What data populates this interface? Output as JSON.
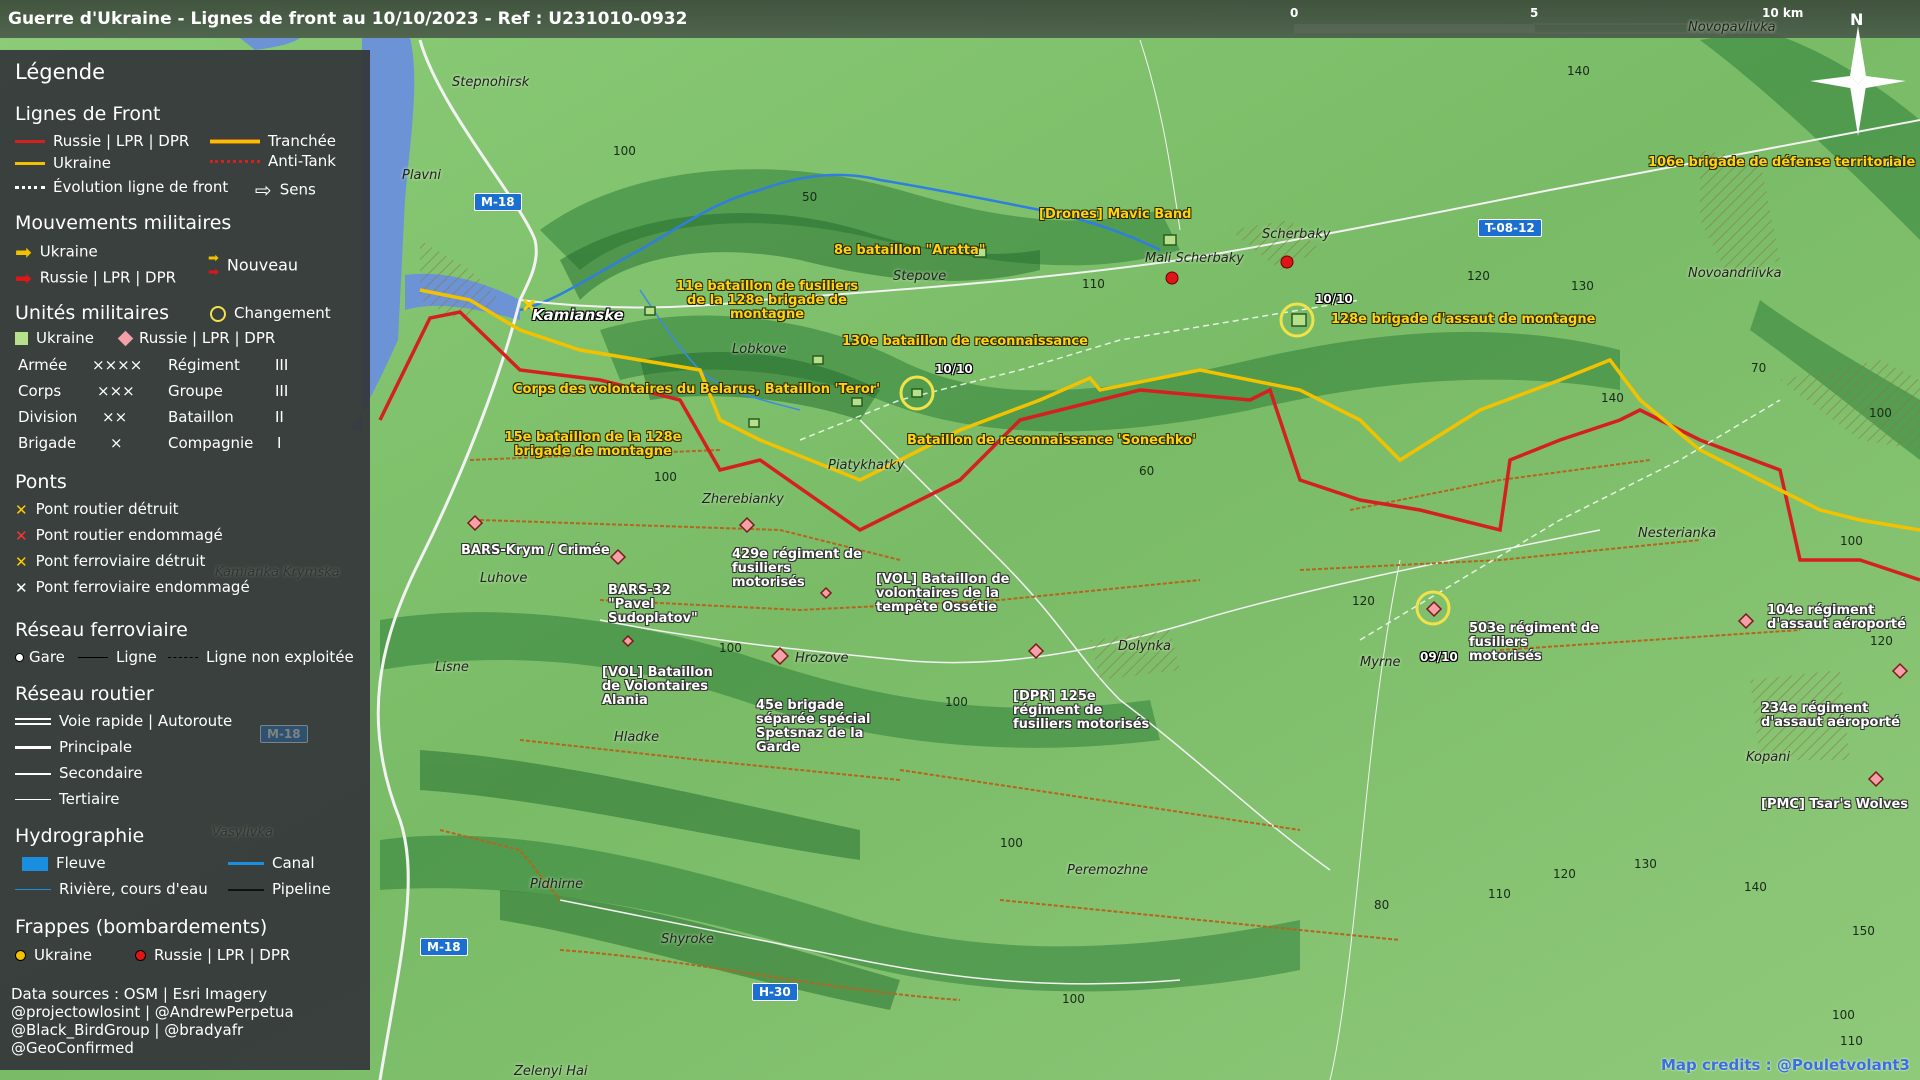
{
  "header": {
    "title": "Guerre d'Ukraine - Lignes de front au 10/10/2023 - Ref : U231010-0932",
    "scale_labels": [
      "0",
      "5",
      "10 km"
    ],
    "north_label": "N"
  },
  "legend": {
    "title": "Légende",
    "front_lines": {
      "heading": "Lignes de Front",
      "items": [
        "Russie | LPR | DPR",
        "Ukraine",
        "Évolution ligne de front",
        "Tranchée",
        "Anti-Tank",
        "Sens"
      ]
    },
    "movements": {
      "heading": "Mouvements militaires",
      "items": [
        "Ukraine",
        "Russie | LPR | DPR",
        "Nouveau"
      ]
    },
    "units": {
      "heading": "Unités militaires",
      "change_label": "Changement",
      "ukraine_label": "Ukraine",
      "russia_label": "Russie | LPR | DPR",
      "echelons": [
        {
          "name": "Armée",
          "symbol": "××××"
        },
        {
          "name": "Corps",
          "symbol": "×××"
        },
        {
          "name": "Division",
          "symbol": "××"
        },
        {
          "name": "Brigade",
          "symbol": "×"
        },
        {
          "name": "Régiment",
          "symbol": "III"
        },
        {
          "name": "Groupe",
          "symbol": "III"
        },
        {
          "name": "Bataillon",
          "symbol": "II"
        },
        {
          "name": "Compagnie",
          "symbol": "I"
        }
      ]
    },
    "bridges": {
      "heading": "Ponts",
      "items": [
        "Pont routier détruit",
        "Pont routier endommagé",
        "Pont ferroviaire détruit",
        "Pont ferroviaire endommagé"
      ],
      "colors": [
        "#ffcc00",
        "#ff3333",
        "#ffcc00",
        "#ffffff"
      ]
    },
    "rail": {
      "heading": "Réseau ferroviaire",
      "items": [
        "Gare",
        "Ligne",
        "Ligne non exploitée"
      ]
    },
    "roads": {
      "heading": "Réseau routier",
      "items": [
        "Voie rapide | Autoroute",
        "Principale",
        "Secondaire",
        "Tertiaire"
      ]
    },
    "hydro": {
      "heading": "Hydrographie",
      "items": [
        "Fleuve",
        "Canal",
        "Rivière, cours d'eau",
        "Pipeline"
      ]
    },
    "strikes": {
      "heading": "Frappes (bombardements)",
      "items": [
        "Ukraine",
        "Russie | LPR | DPR"
      ]
    },
    "credits": [
      "Data sources : OSM | Esri Imagery",
      "@projectowlosint | @AndrewPerpetua",
      "@Black_BirdGroup | @bradyafr",
      "@GeoConfirmed"
    ]
  },
  "map": {
    "colors": {
      "russia": "#d42020",
      "ukraine": "#f2c200",
      "ukraine_unit": "#b7e08a",
      "russia_unit": "#f4a0a8",
      "water": "#6b93d6",
      "river": "#2e7fe0"
    },
    "shields": [
      "M-18",
      "M-18",
      "T-08-12",
      "H-30",
      "M-18"
    ],
    "towns": [
      "Stepnohirsk",
      "Plavni",
      "Kamianske",
      "Lobkove",
      "Stepove",
      "Mali Scherbaky",
      "Scherbaky",
      "Novoandriivka",
      "Novopavlivka",
      "Piatykhatky",
      "Zherebianky",
      "Luhove",
      "Lisne",
      "Hrozove",
      "Dolynka",
      "Myrne",
      "Nesterianka",
      "Hladke",
      "Vasylivka",
      "Kopani",
      "Peremozhne",
      "Pidhirne",
      "Shyroke",
      "Zelenyi Hai",
      "Kamianka Krymska"
    ],
    "elevations": [
      "100",
      "50",
      "110",
      "120",
      "130",
      "140",
      "70",
      "140",
      "100",
      "60",
      "100",
      "100",
      "120",
      "100",
      "100",
      "100",
      "80",
      "110",
      "120",
      "130",
      "140",
      "150",
      "100",
      "110",
      "120",
      "100"
    ],
    "ukraine_units": [
      "106e brigade de défense territoriale",
      "[Drones] Mavic Band",
      "8e bataillon \"Aratta\"",
      "11e bataillon de fusiliers de la 128e brigade de montagne",
      "128e brigade d'assaut de montagne",
      "130e bataillon de reconnaissance",
      "Corps des volontaires du Belarus, Bataillon 'Teror'",
      "15e bataillon de la 128e brigade de montagne",
      "Bataillon de reconnaissance 'Sonechko'"
    ],
    "russia_units": [
      "BARS-Krym / Crimée",
      "BARS-32 \"Pavel Sudoplatov\"",
      "429e régiment de fusiliers motorisés",
      "[VOL] Bataillon de volontaires de la tempête Ossétie",
      "[VOL] Bataillon de Volontaires Alania",
      "45e brigade séparée spécial Spetsnaz de la Garde",
      "[DPR] 125e régiment de fusiliers motorisés",
      "503e régiment de fusiliers motorisés",
      "104e régiment d'assaut aéroporté",
      "234e régiment d'assaut aéroporté",
      "[PMC] Tsar's Wolves"
    ],
    "dates": [
      "10/10",
      "10/10",
      "09/10"
    ],
    "credit": "Map credits : @Pouletvolant3"
  }
}
